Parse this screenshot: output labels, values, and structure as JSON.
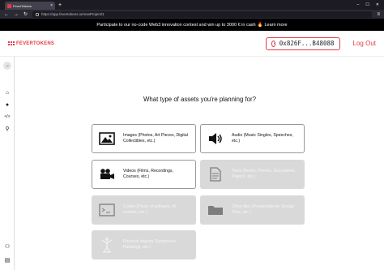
{
  "browser": {
    "tab_title": "FeverTokens",
    "tab_close": "×",
    "new_tab": "+",
    "url": "https://app.fevertokens.io/newProject/1",
    "window_controls": [
      "–",
      "☐",
      "✕"
    ]
  },
  "banner": {
    "text": "Participate to our no-code Web3 innovation contest and win up to 3000 € in cash",
    "emoji": "🔥",
    "link": "Learn more"
  },
  "header": {
    "logo_text": "FEVERTOKENS",
    "wallet_address": "0x826F...B48088",
    "logout_label": "Log Out"
  },
  "sidebar": {
    "toggle_glyph": "→",
    "items": [
      {
        "name": "home-icon",
        "glyph": "⌂"
      },
      {
        "name": "user-icon",
        "glyph": "●"
      },
      {
        "name": "code-icon",
        "glyph": "</>"
      },
      {
        "name": "search-icon",
        "glyph": "⚲"
      }
    ],
    "bottom_items": [
      {
        "name": "community-icon",
        "glyph": "⚇"
      },
      {
        "name": "book-icon",
        "glyph": "▤"
      }
    ]
  },
  "main": {
    "question": "What type of assets you're planning for?",
    "cards": [
      {
        "label": "Images (Photos, Art Pieces, Digital Collectibles, etc.)",
        "icon": "image-icon",
        "enabled": true
      },
      {
        "label": "Audio (Music Singles, Speeches, etc.)",
        "icon": "speaker-icon",
        "enabled": true
      },
      {
        "label": "Videos (Films, Recordings, Courses, etc.)",
        "icon": "video-camera-icon",
        "enabled": true
      },
      {
        "label": "Texts (Books, Poems, Documents, Papers, etc.)",
        "icon": "document-icon",
        "enabled": false
      },
      {
        "label": "Codes (Piece of software, AI models, etc.)",
        "icon": "terminal-icon",
        "enabled": false
      },
      {
        "label": "Other files (Presentations, Design Files, etc.)",
        "icon": "folder-icon",
        "enabled": false
      },
      {
        "label": "Physical objects (Sculptures, Paintings, etc.)",
        "icon": "statue-icon",
        "enabled": false
      }
    ]
  }
}
